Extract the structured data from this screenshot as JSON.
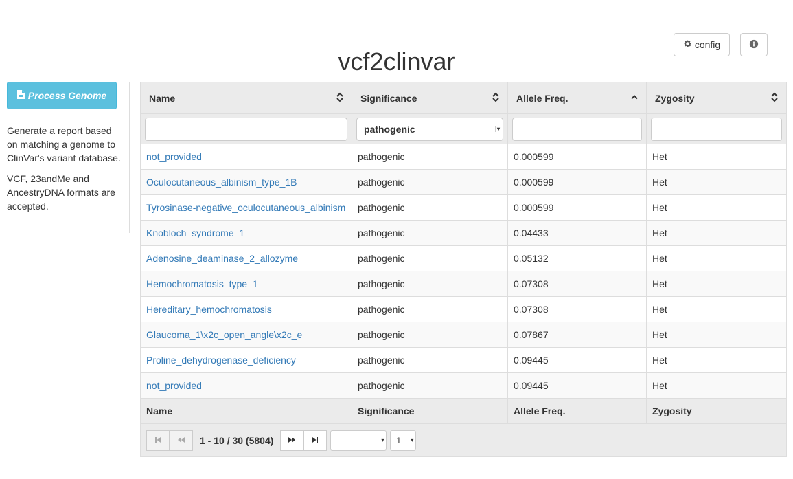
{
  "header": {
    "title": "vcf2clinvar",
    "config_label": "config"
  },
  "sidebar": {
    "process_label": "Process Genome",
    "description": "Generate a report based on matching a genome to ClinVar's variant database.",
    "formats": "VCF, 23andMe and AncestryDNA formats are accepted."
  },
  "table": {
    "columns": [
      "Name",
      "Significance",
      "Allele Freq.",
      "Zygosity"
    ],
    "filters": {
      "name": "",
      "significance": "pathogenic",
      "allele_freq": "",
      "zygosity": ""
    },
    "rows": [
      {
        "name": "not_provided",
        "significance": "pathogenic",
        "freq": "0.000599",
        "zygosity": "Het"
      },
      {
        "name": "Oculocutaneous_albinism_type_1B",
        "significance": "pathogenic",
        "freq": "0.000599",
        "zygosity": "Het"
      },
      {
        "name": "Tyrosinase-negative_oculocutaneous_albinism",
        "significance": "pathogenic",
        "freq": "0.000599",
        "zygosity": "Het"
      },
      {
        "name": "Knobloch_syndrome_1",
        "significance": "pathogenic",
        "freq": "0.04433",
        "zygosity": "Het"
      },
      {
        "name": "Adenosine_deaminase_2_allozyme",
        "significance": "pathogenic",
        "freq": "0.05132",
        "zygosity": "Het"
      },
      {
        "name": "Hemochromatosis_type_1",
        "significance": "pathogenic",
        "freq": "0.07308",
        "zygosity": "Het"
      },
      {
        "name": "Hereditary_hemochromatosis",
        "significance": "pathogenic",
        "freq": "0.07308",
        "zygosity": "Het"
      },
      {
        "name": "Glaucoma_1\\x2c_open_angle\\x2c_e",
        "significance": "pathogenic",
        "freq": "0.07867",
        "zygosity": "Het"
      },
      {
        "name": "Proline_dehydrogenase_deficiency",
        "significance": "pathogenic",
        "freq": "0.09445",
        "zygosity": "Het"
      },
      {
        "name": "not_provided",
        "significance": "pathogenic",
        "freq": "0.09445",
        "zygosity": "Het"
      }
    ],
    "footer": [
      "Name",
      "Significance",
      "Allele Freq.",
      "Zygosity"
    ]
  },
  "pager": {
    "display": "1 - 10 / 30 (5804)",
    "size_value": "",
    "page_value": "1"
  },
  "colors": {
    "accent": "#5bc0de",
    "link": "#337ab7",
    "header_bg": "#ebebeb"
  },
  "icons": {
    "config": "gear-icon",
    "info": "info-icon",
    "process": "file-icon",
    "sort": "sort-icon"
  }
}
